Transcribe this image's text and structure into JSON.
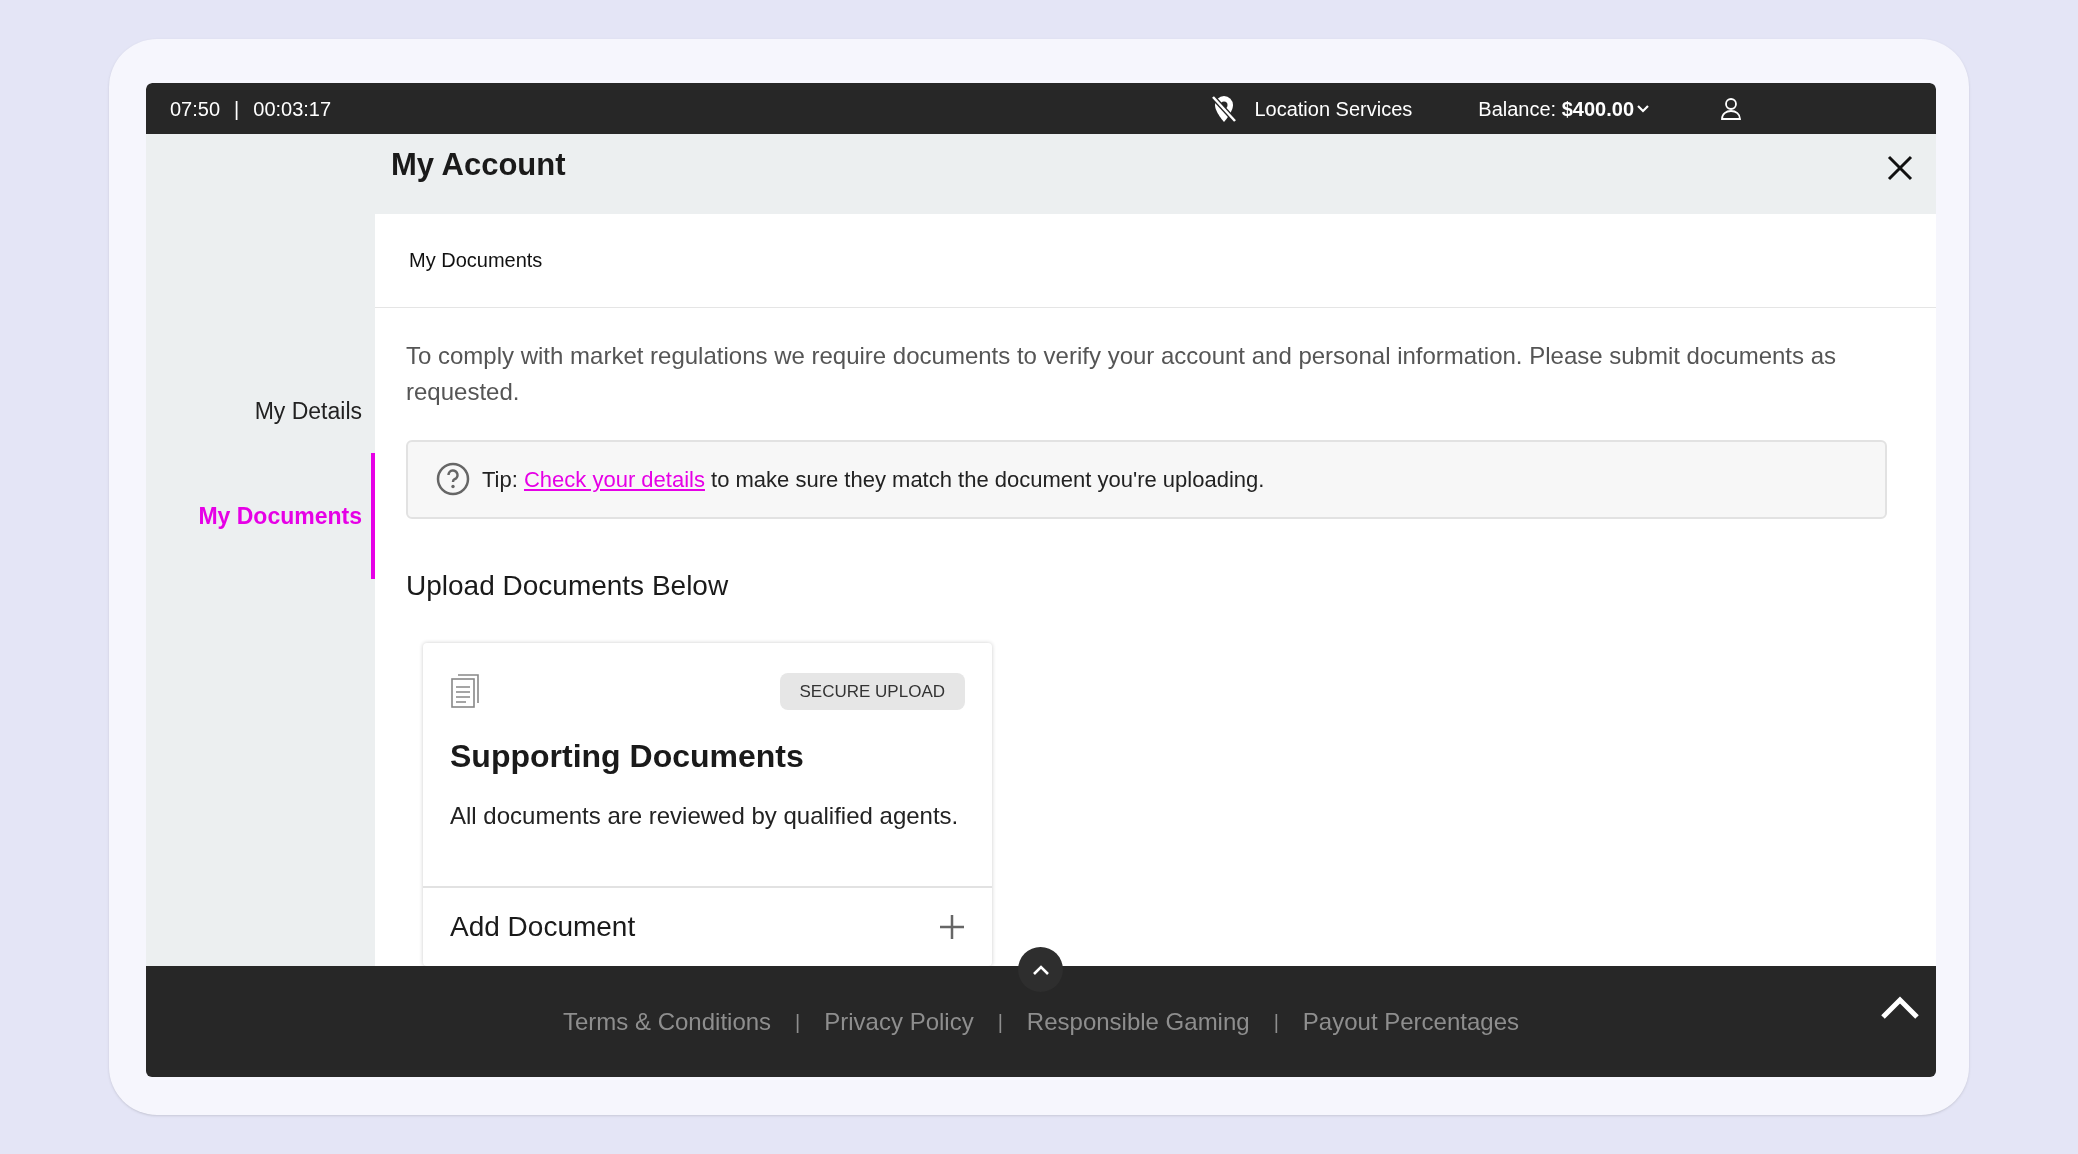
{
  "status_bar": {
    "time": "07:50",
    "separator": "|",
    "timer": "00:03:17",
    "location": "Location Services",
    "balance": "Balance: **$400.00**"
  },
  "header": {
    "title": "My Account"
  },
  "sidebar": {
    "items": [
      {
        "label": "My Details",
        "selected": false
      },
      {
        "label": "My Documents",
        "selected": true
      }
    ]
  },
  "content": {
    "section_title": "My Documents",
    "intro": "To comply with market regulations we require documents to verify your account and personal information. Please submit documents as requested.",
    "tip": {
      "prefix": "Tip:",
      "link": "Check your details",
      "suffix": "to make sure they match the document you're uploading."
    },
    "upload_title": "Upload Documents Below",
    "card": {
      "badge": "SECURE UPLOAD",
      "title": "Supporting Documents",
      "description": "All documents are reviewed by qualified agents.",
      "action": "Add Document"
    }
  },
  "footer": {
    "items": [
      {
        "kind": "link",
        "text": "Terms & Conditions"
      },
      {
        "kind": "separator",
        "text": "|"
      },
      {
        "kind": "link",
        "text": "Privacy Policy"
      },
      {
        "kind": "separator",
        "text": "|"
      },
      {
        "kind": "link",
        "text": "Responsible Gaming"
      },
      {
        "kind": "separator",
        "text": "|"
      },
      {
        "kind": "link",
        "text": "Payout Percentages"
      }
    ]
  }
}
